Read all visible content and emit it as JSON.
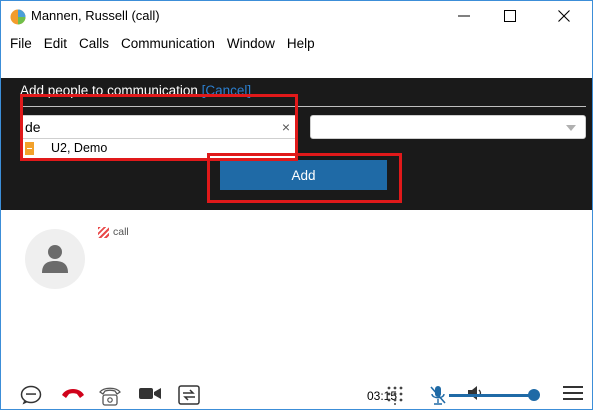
{
  "window": {
    "title": "Mannen, Russell (call)",
    "icons": [
      "app-icon",
      "minimize-icon",
      "maximize-icon",
      "close-icon"
    ]
  },
  "menu": {
    "items": [
      "File",
      "Edit",
      "Calls",
      "Communication",
      "Window",
      "Help"
    ]
  },
  "add_panel": {
    "heading": "Add people to communication",
    "cancel_label": "[Cancel]",
    "search_value": "de",
    "clear_symbol": "×",
    "suggestion": "U2, Demo",
    "select_value": "",
    "add_label": "Add"
  },
  "call": {
    "status": "call"
  },
  "toolbar": {
    "timer": "03:15",
    "icons": [
      "chat-icon",
      "hangup-icon",
      "dialpad-phone-icon",
      "video-icon",
      "transfer-icon",
      "keypad-icon",
      "mic-muted-icon",
      "speaker-icon",
      "menu-icon"
    ],
    "volume_level": 0.97
  },
  "colors": {
    "accent": "#1f6aa6",
    "panel_bg": "#1a1a1a",
    "annotation": "#e0191a",
    "hangup": "#d0021b"
  }
}
